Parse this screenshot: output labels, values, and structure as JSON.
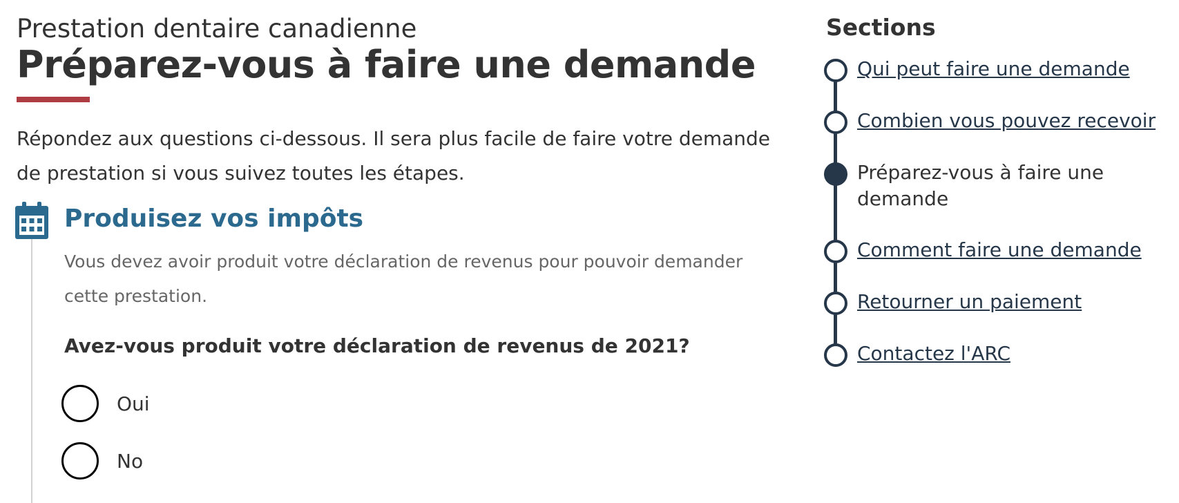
{
  "header": {
    "supertitle": "Prestation dentaire canadienne",
    "title": "Préparez-vous à faire une demande",
    "underline_color": "#af3c43"
  },
  "intro": "Répondez aux questions ci-dessous. Il sera plus facile de faire votre demande de prestation si vous suivez toutes les étapes.",
  "step": {
    "icon": "calendar-icon",
    "title": "Produisez vos impôts",
    "description": "Vous devez avoir produit votre déclaration de revenus pour pouvoir demander cette prestation.",
    "question": "Avez-vous produit votre déclaration de revenus de 2021?",
    "options": [
      {
        "label": "Oui",
        "selected": false
      },
      {
        "label": "No",
        "selected": false
      }
    ]
  },
  "sidebar": {
    "title": "Sections",
    "items": [
      {
        "label": "Qui peut faire une demande",
        "current": false
      },
      {
        "label": "Combien vous pouvez recevoir",
        "current": false
      },
      {
        "label": "Préparez-vous à faire une demande",
        "current": true
      },
      {
        "label": "Comment faire une demande",
        "current": false
      },
      {
        "label": "Retourner un paiement",
        "current": false
      },
      {
        "label": "Contactez l'ARC",
        "current": false
      }
    ]
  },
  "colors": {
    "accent_red": "#af3c43",
    "step_title": "#2b6a8e",
    "nav": "#26374a",
    "text": "#333333",
    "muted": "#666666"
  }
}
